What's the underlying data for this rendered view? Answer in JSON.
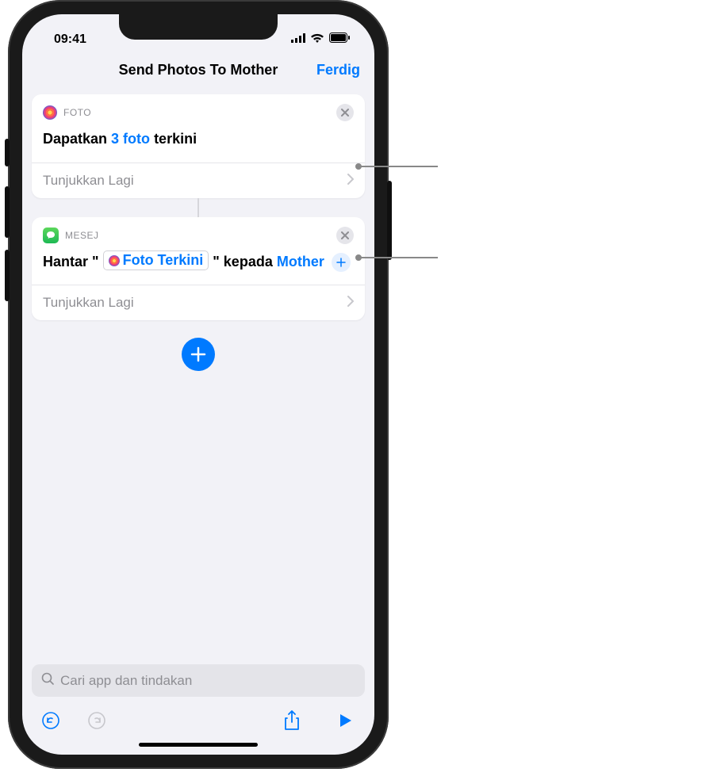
{
  "status": {
    "time": "09:41"
  },
  "nav": {
    "title": "Send Photos To Mother",
    "done": "Ferdig"
  },
  "cards": [
    {
      "app_label": "FOTO",
      "text_prefix": "Dapatkan",
      "param": "3 foto",
      "text_suffix": "terkini",
      "show_more": "Tunjukkan Lagi"
    },
    {
      "app_label": "MESEJ",
      "text_prefix": "Hantar \"",
      "token": "Foto Terkini",
      "text_mid": "\" kepada",
      "recipient": "Mother",
      "show_more": "Tunjukkan Lagi"
    }
  ],
  "search": {
    "placeholder": "Cari app dan tindakan"
  }
}
